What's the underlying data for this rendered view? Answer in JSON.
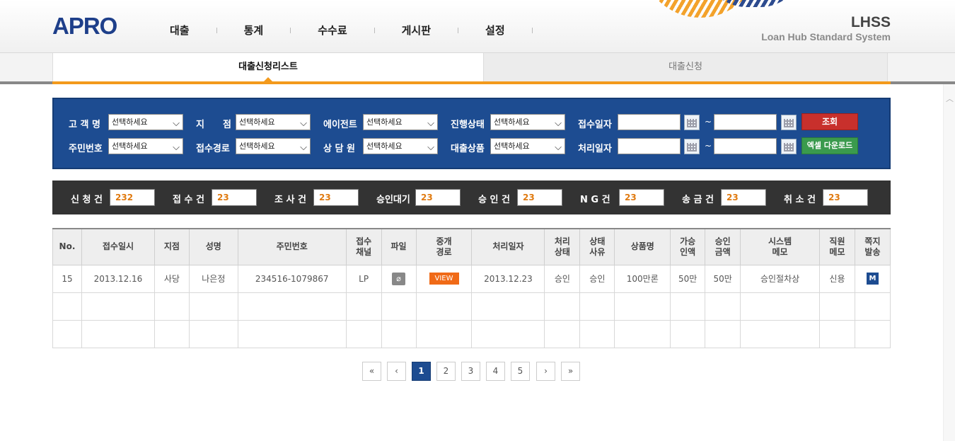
{
  "header": {
    "logo": "APRO",
    "nav": [
      "대출",
      "통계",
      "수수료",
      "게시판",
      "설정"
    ],
    "brand_title": "LHSS",
    "brand_subtitle": "Loan Hub Standard System"
  },
  "tabs": [
    "대출신청리스트",
    "대출신청"
  ],
  "search": {
    "labels": {
      "customer": "고 객 명",
      "branch": "지　　점",
      "agent": "에이전트",
      "status": "진행상태",
      "receipt_date": "접수일자",
      "ssn": "주민번호",
      "channel": "접수경로",
      "counselor": "상 담 원",
      "product": "대출상품",
      "process_date": "처리일자"
    },
    "select_placeholder": "선택하세요",
    "tilde": "~",
    "search_button": "조회",
    "excel_button": "엑셀 다운로드"
  },
  "stats": [
    {
      "label": "신 청 건",
      "value": "232"
    },
    {
      "label": "접 수 건",
      "value": "23"
    },
    {
      "label": "조 사 건",
      "value": "23"
    },
    {
      "label": "승인대기",
      "value": "23"
    },
    {
      "label": "승 인 건",
      "value": "23"
    },
    {
      "label": "N G 건",
      "value": "23"
    },
    {
      "label": "송 금 건",
      "value": "23"
    },
    {
      "label": "취 소 건",
      "value": "23"
    }
  ],
  "table": {
    "headers": [
      "No.",
      "접수일시",
      "지점",
      "성명",
      "주민번호",
      "접수\n채널",
      "파일",
      "중개\n경로",
      "처리일자",
      "처리\n상태",
      "상태\n사유",
      "상품명",
      "가승\n인액",
      "승인\n금액",
      "시스템\n메모",
      "직원\n메모",
      "쪽지\n발송"
    ],
    "rows": [
      {
        "no": "15",
        "date": "2013.12.16",
        "branch": "사당",
        "name": "나은정",
        "ssn": "234516-1079867",
        "channel": "LP",
        "file_icon": "paperclip-icon",
        "route": "VIEW",
        "process_date": "2013.12.23",
        "status": "승인",
        "reason": "승인",
        "product": "100만론",
        "pre_amount": "50만",
        "approved": "50만",
        "sys_memo": "승인절차상",
        "staff_memo": "신용",
        "message": "M"
      }
    ]
  },
  "pagination": {
    "first": "«",
    "prev": "‹",
    "pages": [
      "1",
      "2",
      "3",
      "4",
      "5"
    ],
    "current": "1",
    "next": "›",
    "last": "»"
  },
  "colors": {
    "brand_blue": "#1d4c91",
    "accent_orange": "#f39a1c",
    "search_red": "#c8302c",
    "excel_green": "#3a9a4d"
  }
}
